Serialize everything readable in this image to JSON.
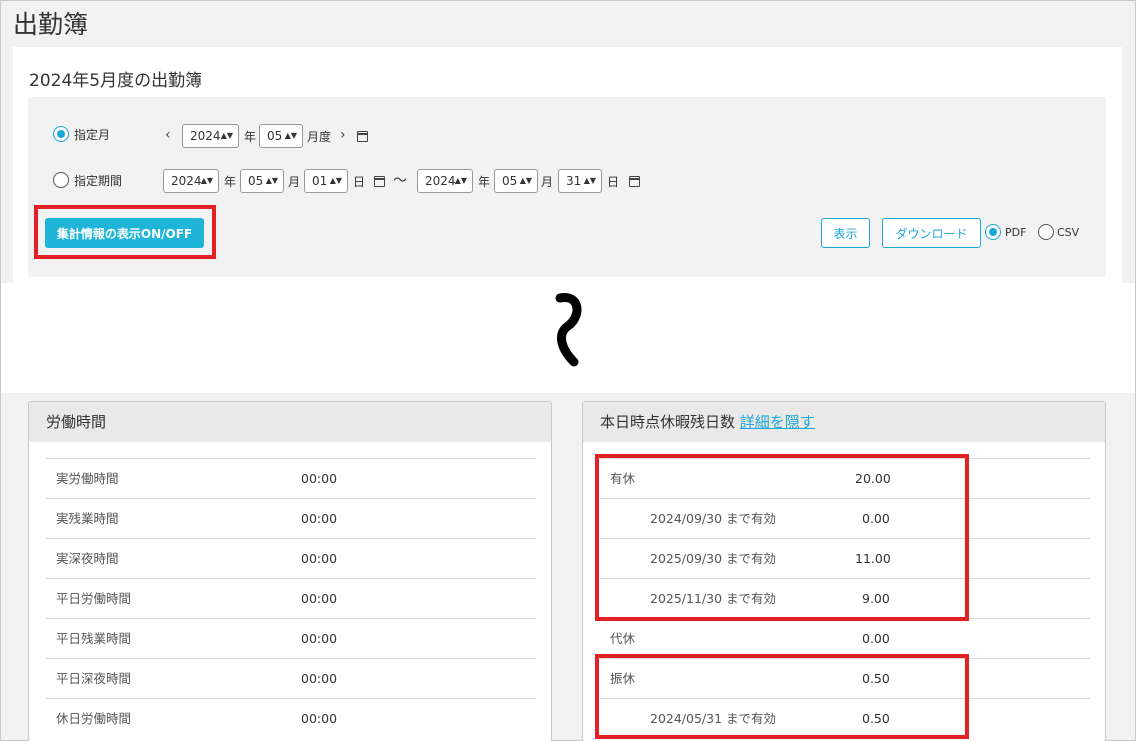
{
  "page_title": "出勤簿",
  "card_title": "2024年5月度の出勤簿",
  "filter": {
    "month_mode_label": "指定月",
    "period_mode_label": "指定期間",
    "selected_mode": "指定月",
    "month": {
      "year": "2024",
      "year_suffix": "年",
      "month": "05",
      "month_suffix": "月度"
    },
    "period": {
      "from": {
        "year": "2024",
        "month": "05",
        "day": "01"
      },
      "to": {
        "year": "2024",
        "month": "05",
        "day": "31"
      },
      "year_suffix": "年",
      "month_suffix": "月",
      "day_suffix": "日",
      "separator": "〜"
    },
    "aggregate_toggle_label": "集計情報の表示ON/OFF",
    "display_button_label": "表示",
    "download_button_label": "ダウンロード",
    "format_options": [
      "PDF",
      "CSV"
    ],
    "selected_format": "PDF"
  },
  "labor_panel": {
    "title": "労働時間",
    "rows": [
      {
        "label": "実労働時間",
        "value": "00:00"
      },
      {
        "label": "実残業時間",
        "value": "00:00"
      },
      {
        "label": "実深夜時間",
        "value": "00:00"
      },
      {
        "label": "平日労働時間",
        "value": "00:00"
      },
      {
        "label": "平日残業時間",
        "value": "00:00"
      },
      {
        "label": "平日深夜時間",
        "value": "00:00"
      },
      {
        "label": "休日労働時間",
        "value": "00:00"
      }
    ]
  },
  "leave_panel": {
    "title": "本日時点休暇残日数",
    "toggle_link": "詳細を隠す",
    "rows": [
      {
        "label": "有休",
        "value": "20.00"
      },
      {
        "label": "2024/09/30 まで有効",
        "value": "0.00"
      },
      {
        "label": "2025/09/30 まで有効",
        "value": "11.00"
      },
      {
        "label": "2025/11/30 まで有効",
        "value": "9.00"
      },
      {
        "label": "代休",
        "value": "0.00"
      },
      {
        "label": "振休",
        "value": "0.50"
      },
      {
        "label": "2024/05/31 まで有効",
        "value": "0.50"
      }
    ]
  },
  "colors": {
    "accent": "#1fb5d8",
    "highlight": "#e32124"
  }
}
